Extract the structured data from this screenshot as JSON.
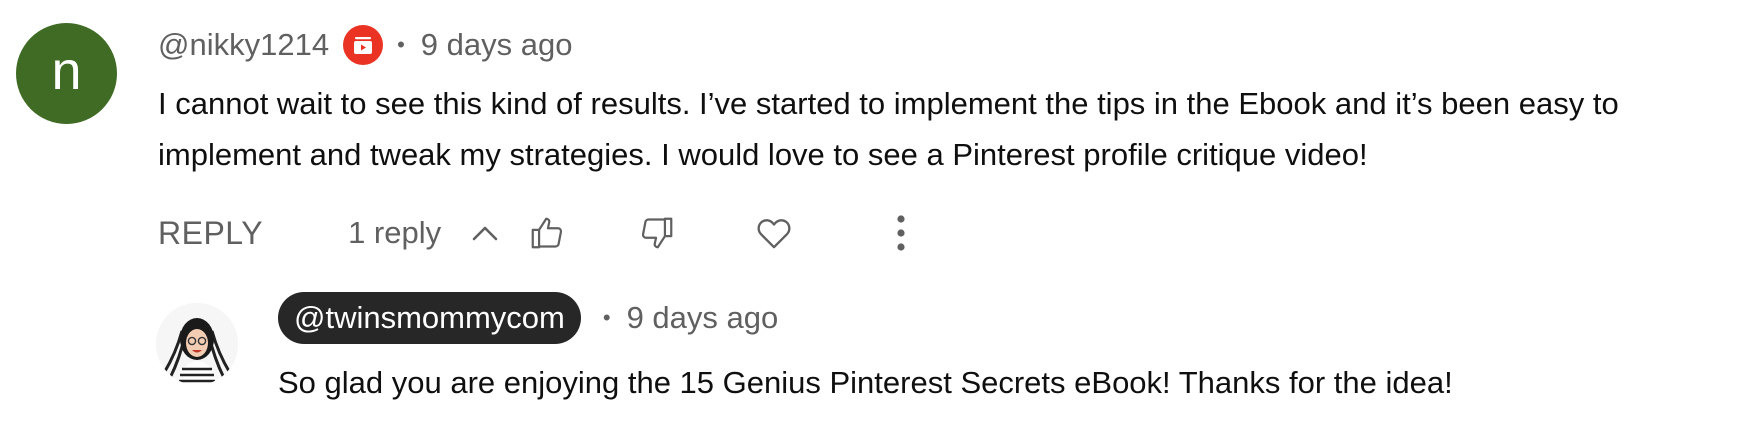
{
  "comment": {
    "avatar_letter": "n",
    "author": "@nikky1214",
    "badge_icon": "member-badge-icon",
    "separator": "•",
    "timestamp": "9 days ago",
    "text": "I cannot wait to see this kind of results. I’ve started to implement the tips in the Ebook and  it’s been easy to implement and tweak my strategies. I would love to see a Pinterest profile critique video!"
  },
  "actions": {
    "reply_label": "REPLY",
    "replies_label": "1 reply",
    "icons": [
      "chevron-up-icon",
      "thumbs-up-icon",
      "thumbs-down-icon",
      "heart-icon",
      "more-vertical-icon"
    ]
  },
  "reply": {
    "author": "@twinsmommycom",
    "separator": "•",
    "timestamp": "9 days ago",
    "text": "So glad you are enjoying the 15 Genius Pinterest Secrets eBook! Thanks for the idea!"
  },
  "colors": {
    "avatar_bg": "#3f6b25",
    "badge_red": "#ea3323",
    "chip_bg": "#272727",
    "secondary_text": "#606060"
  }
}
